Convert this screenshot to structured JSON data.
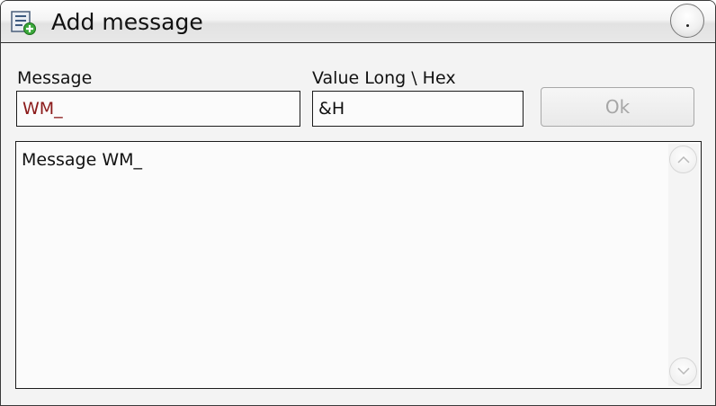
{
  "window": {
    "title": "Add message",
    "title_icon": "add-document-icon",
    "close_icon": "close-circle-icon"
  },
  "form": {
    "message_label": "Message",
    "message_value": "WM_",
    "message_text_color": "#8b1a1a",
    "value_label": "Value Long \\ Hex",
    "value_value": "&H",
    "ok_label": "Ok",
    "ok_enabled": false
  },
  "list": {
    "items": [
      "Message WM_"
    ],
    "scroll_up_icon": "scroll-up-arrow-icon",
    "scroll_down_icon": "scroll-down-arrow-icon"
  }
}
